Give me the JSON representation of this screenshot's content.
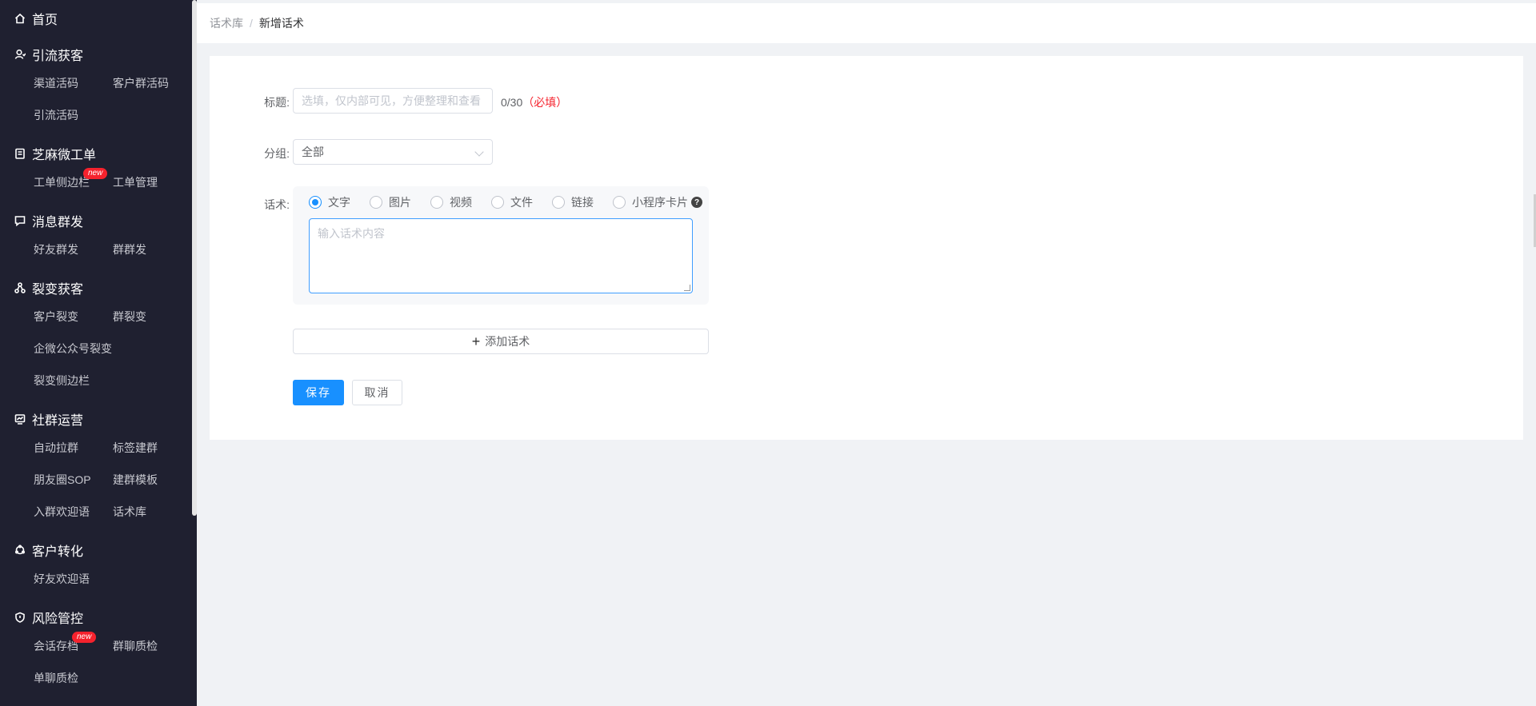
{
  "sidebar": {
    "home": "首页",
    "sections": [
      {
        "title": "引流获客",
        "icon": "user-icon",
        "items": [
          "渠道活码",
          "客户群活码",
          "引流活码"
        ]
      },
      {
        "title": "芝麻微工单",
        "icon": "clipboard-icon",
        "items": [
          "工单侧边栏",
          "工单管理"
        ],
        "badge": "new"
      },
      {
        "title": "消息群发",
        "icon": "message-icon",
        "items": [
          "好友群发",
          "群群发"
        ]
      },
      {
        "title": "裂变获客",
        "icon": "network-icon",
        "items": [
          "客户裂变",
          "群裂变",
          "企微公众号裂变",
          "裂变侧边栏"
        ]
      },
      {
        "title": "社群运营",
        "icon": "chart-icon",
        "items": [
          "自动拉群",
          "标签建群",
          "朋友圈SOP",
          "建群模板",
          "入群欢迎语",
          "话术库"
        ]
      },
      {
        "title": "客户转化",
        "icon": "cycle-icon",
        "items": [
          "好友欢迎语"
        ]
      },
      {
        "title": "风险管控",
        "icon": "shield-icon",
        "items": [
          "会话存档",
          "群聊质检",
          "单聊质检"
        ],
        "badge": "new"
      }
    ]
  },
  "breadcrumb": {
    "parent": "话术库",
    "separator": "/",
    "current": "新增话术"
  },
  "form": {
    "title_label": "标题:",
    "title_placeholder": "选填，仅内部可见，方便整理和查看",
    "title_counter": "0/30",
    "title_required": "（必填）",
    "group_label": "分组:",
    "group_value": "全部",
    "huashu_label": "话术:",
    "types": [
      "文字",
      "图片",
      "视频",
      "文件",
      "链接",
      "小程序卡片"
    ],
    "selected_type": "文字",
    "help": "?",
    "content_placeholder": "输入话术内容",
    "add_label": "添加话术",
    "save_label": "保存",
    "cancel_label": "取消"
  },
  "colors": {
    "primary": "#1890ff",
    "sidebar_bg": "#1f2030",
    "badge": "#f5222d"
  }
}
